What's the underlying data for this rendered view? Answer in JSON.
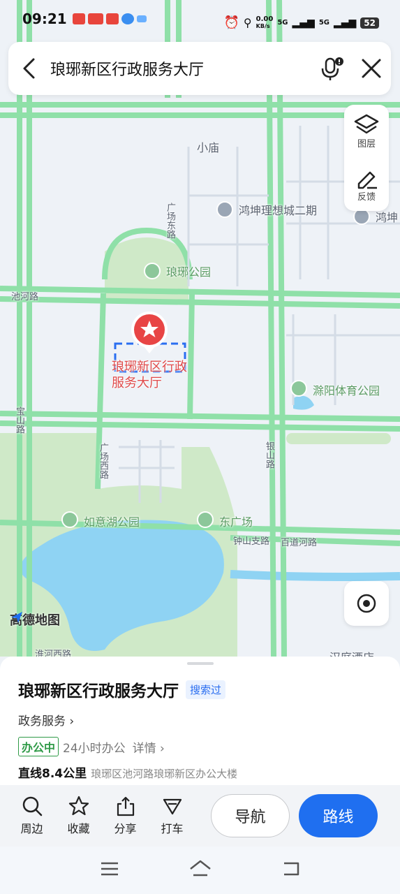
{
  "status_bar": {
    "time": "09:21",
    "network_speed_top": "0.00",
    "network_speed_unit": "KB/s",
    "signal_1": "5G",
    "signal_2": "5G",
    "battery": "52"
  },
  "search": {
    "query": "琅琊新区行政服务大厅"
  },
  "map_tools": {
    "layers_label": "图层",
    "feedback_label": "反馈"
  },
  "map": {
    "labels": {
      "xiaomiao": "小庙",
      "hongkun": "鸿坤理想城二期",
      "hongkun_cut": "鸿坤",
      "guangchang_east": "广场东路",
      "langya_park": "琅琊公园",
      "chihe_road": "池河路",
      "chuyang_sports": "滁阳体育公园",
      "baoshan_road": "宝山路",
      "guangchang_west": "广场西路",
      "yinshan_road": "银山路",
      "ruyi_lake_park": "如意湖公园",
      "east_square": "东广场",
      "zhongshan_branch": "钟山支路",
      "baidao_river": "百道河路",
      "bottom_cut_road": "淮河西路",
      "bottom_cut_poi": "汉庭酒店"
    },
    "marker_label": "琅琊新区行政服务大厅",
    "logo_text": "高德地图",
    "colors": {
      "road_green": "#8fe0a8",
      "park": "#cfe9c8",
      "water": "#8fd3f3",
      "marker": "#e84545"
    }
  },
  "poi": {
    "title": "琅琊新区行政服务大厅",
    "searched_badge": "搜索过",
    "category": "政务服务 ›",
    "open_status": "办公中",
    "hours": "24小时办公",
    "details": "详情 ›",
    "distance": "直线8.4公里",
    "address": "琅琊区池河路琅琊新区办公大楼"
  },
  "actions": {
    "nearby": "周边",
    "favorite": "收藏",
    "share": "分享",
    "taxi": "打车",
    "navigate": "导航",
    "route": "路线"
  },
  "accent_color": "#1f6ff0"
}
